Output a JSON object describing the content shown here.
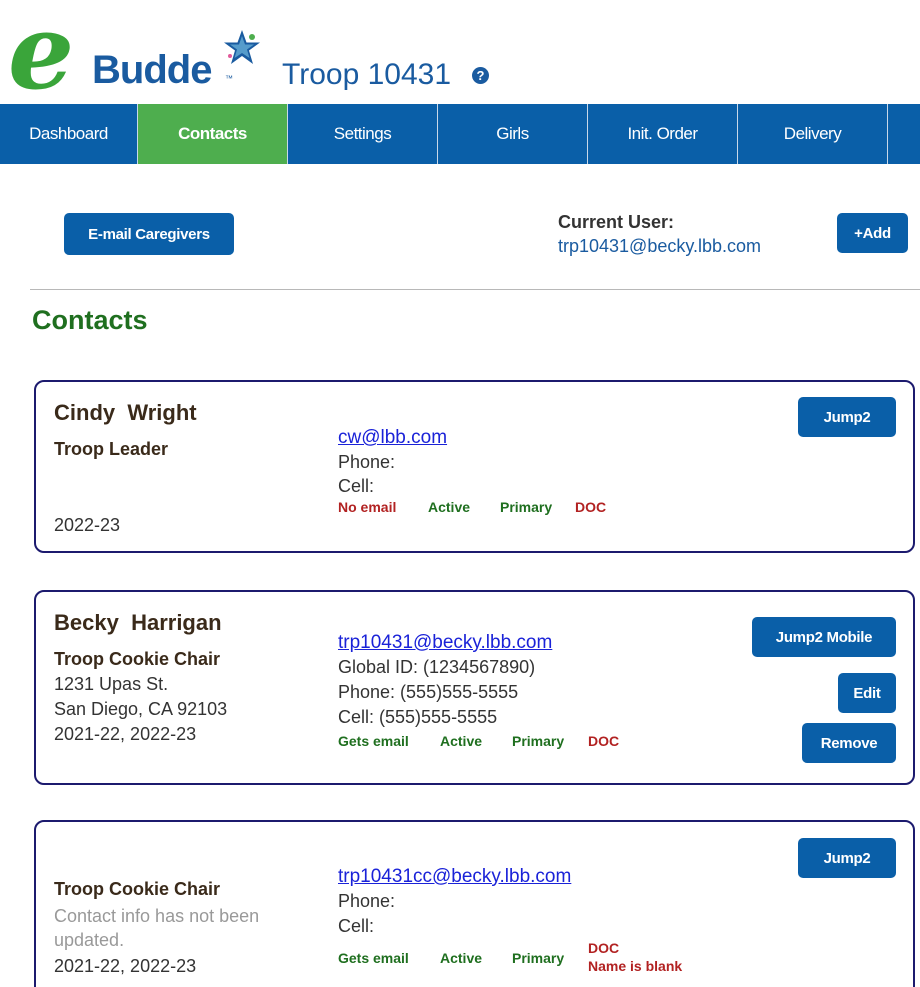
{
  "header": {
    "logo_e": "e",
    "logo_text": "Budde",
    "logo_tm": "™",
    "troop_title": "Troop 10431",
    "help_icon": "?"
  },
  "nav": [
    "Dashboard",
    "Contacts",
    "Settings",
    "Girls",
    "Init. Order",
    "Delivery"
  ],
  "actions": {
    "email_caregivers": "E-mail Caregivers",
    "current_user_label": "Current User:",
    "current_user": "trp10431@becky.lbb.com",
    "add": "+Add"
  },
  "section_title": "Contacts",
  "contacts": [
    {
      "first": "Cindy",
      "last": "Wright",
      "role": "Troop Leader",
      "years": "2022-23",
      "email": "cw@lbb.com",
      "phone": "Phone:",
      "cell": "Cell:",
      "tags": [
        "No email",
        "Active",
        "Primary",
        "DOC"
      ],
      "button": "Jump2"
    },
    {
      "first": "Becky",
      "last": "Harrigan",
      "role": "Troop Cookie Chair",
      "address1": "1231 Upas St.",
      "address2": "San Diego, CA 92103",
      "years": "2021-22, 2022-23",
      "email": "trp10431@becky.lbb.com",
      "global_id": "Global ID:  (1234567890)",
      "phone": "Phone: (555)555-5555",
      "cell": "Cell: (555)555-5555",
      "tags": [
        "Gets email",
        "Active",
        "Primary",
        "DOC"
      ],
      "buttons": [
        "Jump2 Mobile",
        "Edit",
        "Remove"
      ]
    },
    {
      "role": "Troop Cookie Chair",
      "note": "Contact info has not been updated.",
      "years": "2021-22, 2022-23",
      "email": "trp10431cc@becky.lbb.com",
      "phone": "Phone:",
      "cell": "Cell:",
      "tags": [
        "Gets email",
        "Active",
        "Primary",
        "DOC"
      ],
      "name_blank": "Name is blank",
      "button": "Jump2"
    }
  ],
  "colors": {
    "brand_blue": "#0a5fa8",
    "nav_active": "#4eae4e",
    "card_border": "#1c1a6e",
    "section_green": "#1f6f1f",
    "tag_red": "#b22222"
  }
}
